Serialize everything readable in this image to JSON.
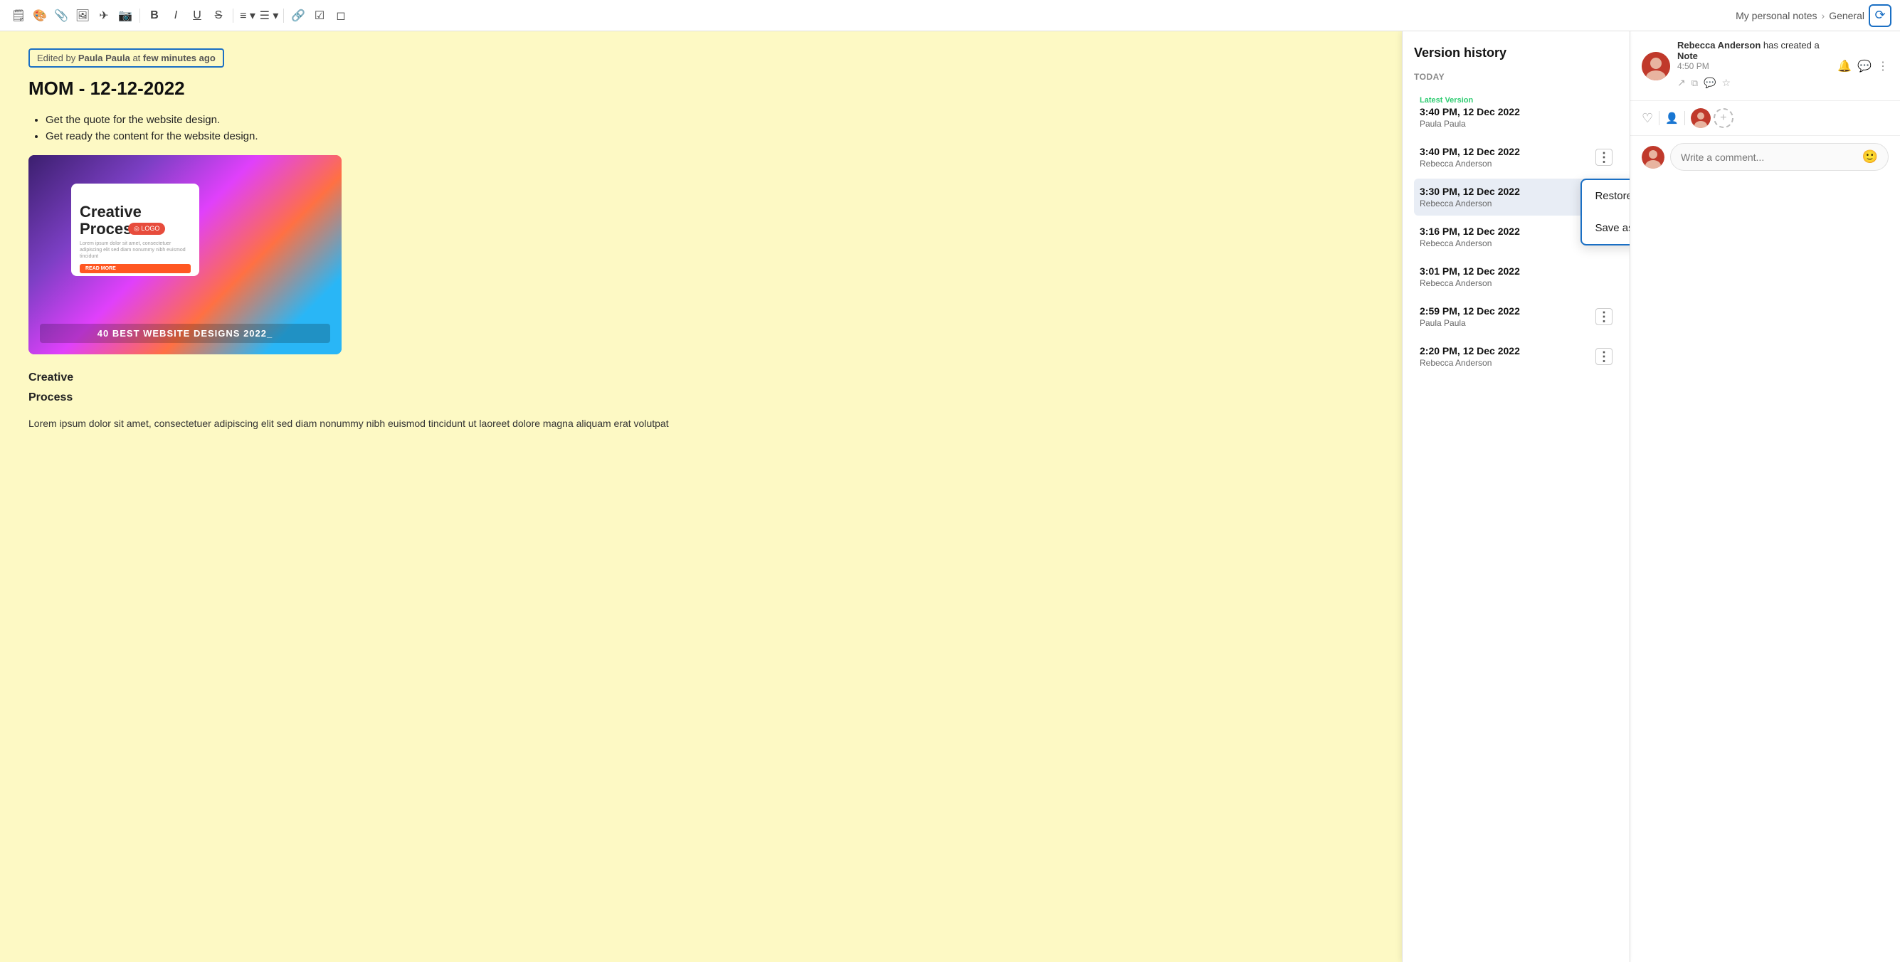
{
  "toolbar": {
    "icons": [
      {
        "name": "note-icon",
        "symbol": "🗒"
      },
      {
        "name": "palette-icon",
        "symbol": "🎨"
      },
      {
        "name": "attach-icon",
        "symbol": "📎"
      },
      {
        "name": "image-icon",
        "symbol": "🖼"
      },
      {
        "name": "send-icon",
        "symbol": "✈"
      },
      {
        "name": "media-icon",
        "symbol": "📷"
      },
      {
        "name": "bold-icon",
        "symbol": "B"
      },
      {
        "name": "italic-icon",
        "symbol": "I"
      },
      {
        "name": "underline-icon",
        "symbol": "U"
      },
      {
        "name": "strikethrough-icon",
        "symbol": "S"
      },
      {
        "name": "align-icon",
        "symbol": "≡"
      },
      {
        "name": "list-icon",
        "symbol": "☰"
      },
      {
        "name": "link-icon",
        "symbol": "🔗"
      },
      {
        "name": "checkbox-icon",
        "symbol": "☑"
      },
      {
        "name": "eraser-icon",
        "symbol": "◻"
      }
    ],
    "breadcrumb": {
      "note": "My personal notes",
      "separator": "›",
      "section": "General"
    },
    "history_icon": "⟳"
  },
  "editor": {
    "edit_info": {
      "prefix": "Edited by",
      "author": "Paula Paula",
      "middle": "at",
      "time": "few minutes ago"
    },
    "title": "MOM - 12-12-2022",
    "bullets": [
      "Get the quote for the website design.",
      "Get ready the content for the website design."
    ],
    "image_caption": "40 BEST WEBSITE DESIGNS 2022_",
    "logo_text": "◎ LOGO",
    "creative_title": "Creative",
    "creative_subtitle": "Process.",
    "creative_lorem": "Lorem ipsum dolor sit amet, consectetuer adipiscing elit sed diam nonummy nibh euismod tincidunt ut laoreet",
    "read_more": "READ MORE",
    "sections": [
      {
        "heading": "Creative"
      },
      {
        "heading": "Process"
      }
    ],
    "body_text": "Lorem ipsum dolor sit amet, consectetuer adipiscing elit sed diam nonummy nibh euismod tincidunt ut laoreet dolore magna aliquam erat volutpat"
  },
  "version_history": {
    "title": "Version history",
    "section_today": "TODAY",
    "versions": [
      {
        "latest_label": "Latest Version",
        "time": "3:40 PM, 12 Dec 2022",
        "author": "Paula Paula",
        "is_latest": true,
        "selected": false,
        "show_menu": false
      },
      {
        "time": "3:40 PM, 12 Dec 2022",
        "author": "Rebecca Anderson",
        "is_latest": false,
        "selected": false,
        "show_menu": true
      },
      {
        "time": "3:30 PM, 12 Dec 2022",
        "author": "Rebecca Anderson",
        "is_latest": false,
        "selected": true,
        "show_menu": true,
        "show_context": true
      },
      {
        "time": "3:16 PM, 12 Dec 2022",
        "author": "Rebecca Anderson",
        "is_latest": false,
        "selected": false,
        "show_menu": false
      },
      {
        "time": "3:01 PM, 12 Dec 2022",
        "author": "Rebecca Anderson",
        "is_latest": false,
        "selected": false,
        "show_menu": false
      },
      {
        "time": "2:59 PM, 12 Dec 2022",
        "author": "Paula Paula",
        "is_latest": false,
        "selected": false,
        "show_menu": true
      },
      {
        "time": "2:20 PM, 12 Dec 2022",
        "author": "Rebecca Anderson",
        "is_latest": false,
        "selected": false,
        "show_menu": true
      }
    ],
    "context_menu": {
      "restore_label": "Restore this version",
      "save_new_label": "Save as new"
    }
  },
  "right_sidebar": {
    "notification": {
      "author": "Rebecca Anderson",
      "action": "has created a",
      "item": "Note",
      "time": "4:50 PM",
      "icons": [
        "external-link-icon",
        "copy-icon",
        "comment-icon",
        "star-icon"
      ],
      "more_icon": "⋮"
    },
    "reactions": {
      "heart_icon": "♡",
      "person_icon": "👤"
    },
    "comment": {
      "placeholder": "Write a comment...",
      "emoji_icon": "🙂"
    }
  }
}
